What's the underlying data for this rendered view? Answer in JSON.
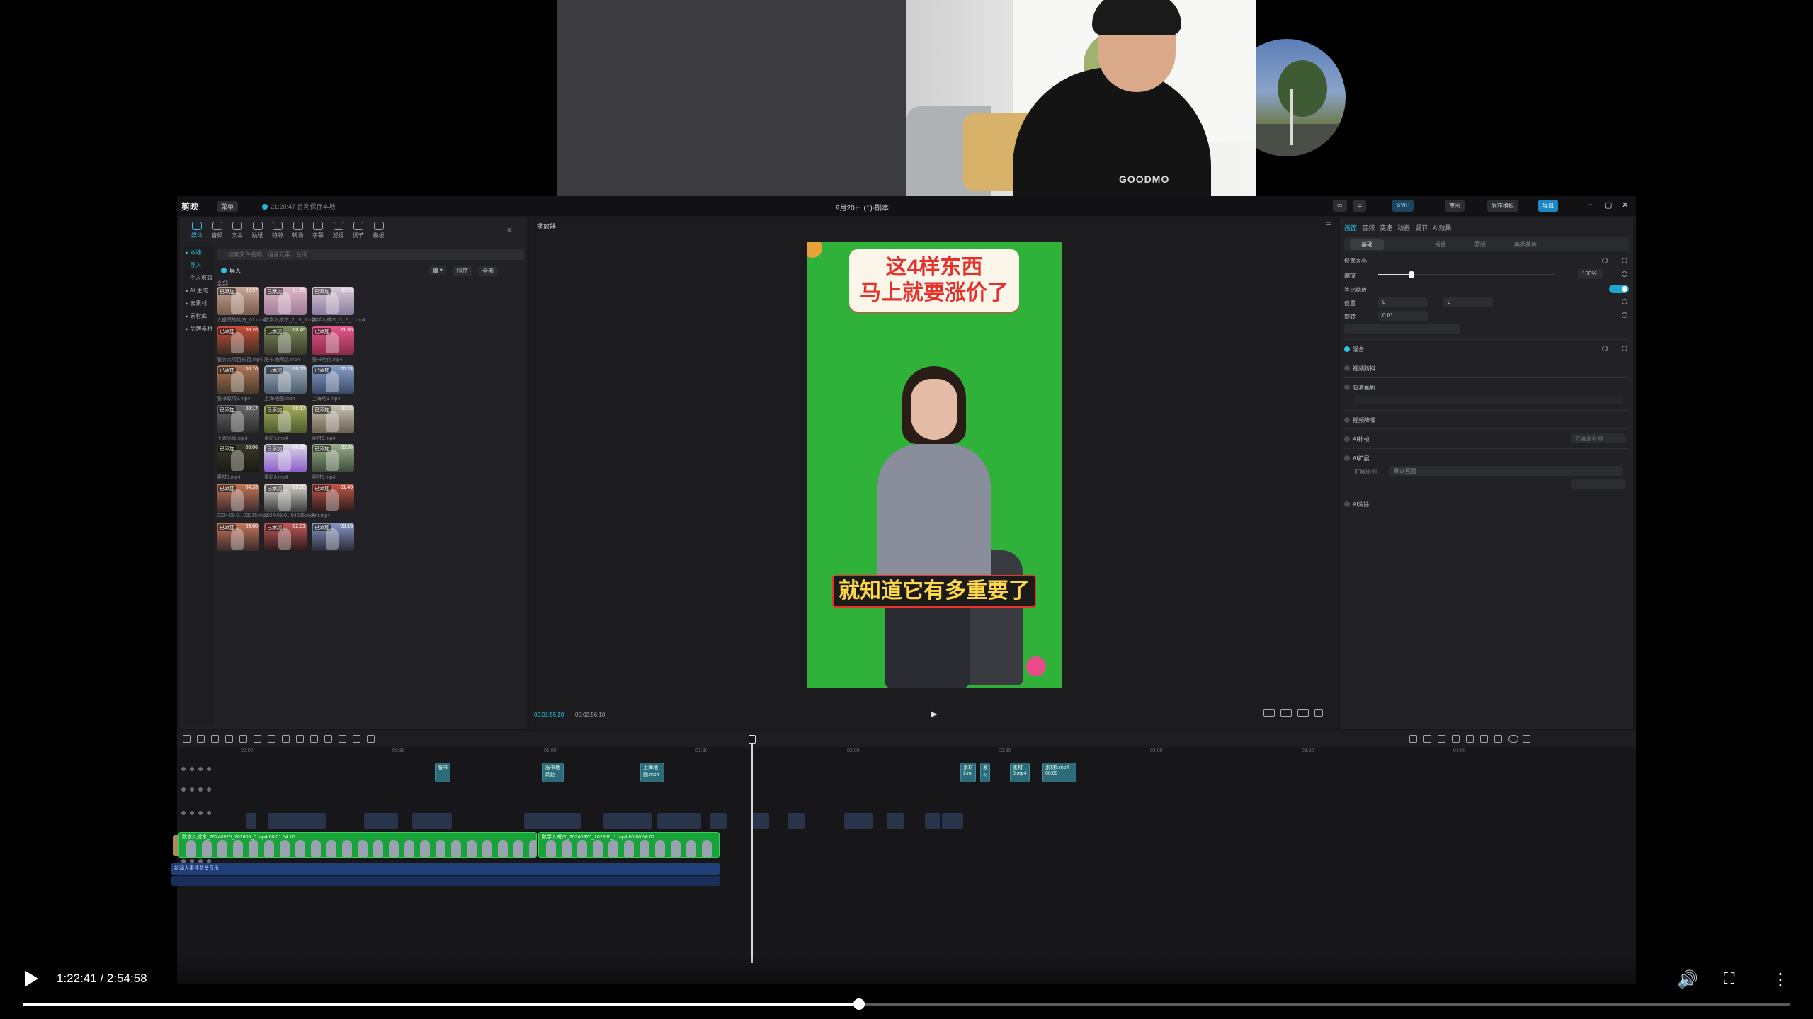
{
  "webcam": {
    "shirt_text": "GOODMO"
  },
  "app": {
    "logo": "剪映",
    "menu_label": "菜单",
    "save_status": "21:20:47 自动保存本地",
    "project_title": "9月20日 (1)-副本",
    "header_buttons": {
      "vip": "SVIP",
      "review": "审阅",
      "publish": "发布模板",
      "export": "导出"
    }
  },
  "left_panel": {
    "tools": [
      "媒体",
      "音频",
      "文本",
      "贴纸",
      "特效",
      "转场",
      "字幕",
      "滤镜",
      "调节",
      "模板"
    ],
    "subnav": [
      "本地",
      "导入",
      "个人剪辑",
      "AI 生成",
      "云素材",
      "素材库",
      "品牌素材"
    ],
    "search_placeholder": "搜索文件名称、语音元素、台词",
    "import_label": "导入",
    "sort_label": "排序",
    "filter_label": "全部",
    "all_label": "全部",
    "media": [
      {
        "tag": "已添加",
        "dur": "02:57",
        "name": "大自然的地方_01.mp4",
        "c1": "#c9a89a",
        "c2": "#7a5a4a"
      },
      {
        "tag": "已添加",
        "dur": "01:55",
        "name": "数学入成本_2_.5_0.mp4",
        "c1": "#e0b9c8",
        "c2": "#a07a98"
      },
      {
        "tag": "已添加",
        "dur": "00:59",
        "name": "数学入成本_3_.5_1.mp4",
        "c1": "#dcc9d8",
        "c2": "#8a7ca0"
      },
      {
        "tag": "已添加",
        "dur": "00:20",
        "name": "服务大项目长目.mp4",
        "c1": "#c8503a",
        "c2": "#3a2a22"
      },
      {
        "tag": "已添加",
        "dur": "00:40",
        "name": "服书地网路.mp4",
        "c1": "#7a8a5a",
        "c2": "#3a3a2a"
      },
      {
        "tag": "已添加",
        "dur": "01:00",
        "name": "服书地化.mp4",
        "c1": "#e25a8a",
        "c2": "#8a2a4a"
      },
      {
        "tag": "已添加",
        "dur": "00:10",
        "name": "服书篇项1.mp4",
        "c1": "#b0785a",
        "c2": "#4a3a2a"
      },
      {
        "tag": "已添加",
        "dur": "00:13",
        "name": "上海地图.mp4",
        "c1": "#9fb0c0",
        "c2": "#4a5a6a"
      },
      {
        "tag": "已添加",
        "dur": "00:24",
        "name": "上海地3.mp4",
        "c1": "#8aa0c8",
        "c2": "#3a4a6a"
      },
      {
        "tag": "已添加",
        "dur": "00:17",
        "name": "上海品风.mp4",
        "c1": "#6a6a6a",
        "c2": "#2a2a2a"
      },
      {
        "tag": "已添加",
        "dur": "00:17",
        "name": "素材1.mp4",
        "c1": "#a8b060",
        "c2": "#4a5a2a"
      },
      {
        "tag": "已添加",
        "dur": "00:15",
        "name": "素材2.mp4",
        "c1": "#c8c0b0",
        "c2": "#6a6050"
      },
      {
        "tag": "已添加",
        "dur": "00:06",
        "name": "素材3.mp4",
        "c1": "#3a3a2a",
        "c2": "#1a1a12"
      },
      {
        "tag": "已添加",
        "dur": "00:15",
        "name": "素材4.mp4",
        "c1": "#dcdce8",
        "c2": "#8a5ac8"
      },
      {
        "tag": "已添加",
        "dur": "00:26",
        "name": "素材5.mp4",
        "c1": "#9ab08a",
        "c2": "#3a4a3a"
      },
      {
        "tag": "已添加",
        "dur": "04:28",
        "name": "2024-09-2...03215.mov",
        "c1": "#c87a5a",
        "c2": "#3a2a2a"
      },
      {
        "tag": "已添加",
        "dur": "03:00",
        "name": "2024-09-0...04235.mov",
        "c1": "#dcd8d0",
        "c2": "#3a3a3a"
      },
      {
        "tag": "已添加",
        "dur": "01:46",
        "name": "Ent.mp4",
        "c1": "#c85a4a",
        "c2": "#2a1a1a"
      },
      {
        "tag": "已添加",
        "dur": "03:00",
        "name": "",
        "c1": "#c8785a",
        "c2": "#3a2a2a"
      },
      {
        "tag": "已添加",
        "dur": "02:51",
        "name": "",
        "c1": "#c85a5a",
        "c2": "#2a1a1a"
      },
      {
        "tag": "已添加",
        "dur": "05:16",
        "name": "",
        "c1": "#8a9ac8",
        "c2": "#2a2a3a"
      }
    ]
  },
  "player": {
    "title": "播放器",
    "banner_line1": "这4样东西",
    "banner_line2": "马上就要涨价了",
    "subtitle": "就知道它有多重要了",
    "current_time": "00:01:55:28",
    "total_time": "00:02:56:10",
    "bg_color": "#2fb13a"
  },
  "right_panel": {
    "tabs": [
      "画面",
      "音频",
      "变速",
      "动画",
      "调节",
      "AI效果"
    ],
    "subtabs": [
      "基础",
      "抠像",
      "蒙版",
      "美颜美体"
    ],
    "position_size": "位置大小",
    "scale_label": "缩放",
    "scale_value": "100%",
    "uniform_scale": "等比缩放",
    "position_label": "位置",
    "pos_x": "0",
    "pos_y": "0",
    "rotate_label": "旋转",
    "rotate_value": "0.0°",
    "blend": "混合",
    "stabilize": "视频防抖",
    "super_res": "超清画质",
    "noise": "视频降噪",
    "ai_fill": "AI补帧",
    "ai_expand": "AI扩展",
    "ai_clean": "AI消除",
    "fill_btn": "去画面补帧",
    "expand_ratio_label": "扩展比例",
    "expand_ratio_value": "默认画面",
    "accent": "#2cc4e6"
  },
  "timeline": {
    "ruler": [
      "00:00",
      "00:30",
      "01:00",
      "01:30",
      "02:00",
      "02:30",
      "03:00",
      "03:30",
      "04:00"
    ],
    "overlay_clips": [
      "服书",
      "服书地网路",
      "上海地图.mp4",
      "素材2.m",
      "素材",
      "素材3.mp4",
      "素材5.mp4  00:09"
    ],
    "main_clip_1": "数学入成本_20240920_202806_0.mp4  00:01:54:10",
    "main_clip_2": "数学入成本_20240920_202806_1.mp4  00:00:58:02",
    "bg_track_label": "新闻大事件背景音乐"
  },
  "youtube": {
    "time": "1:22:41 / 2:54:58",
    "progress": 0.473
  }
}
